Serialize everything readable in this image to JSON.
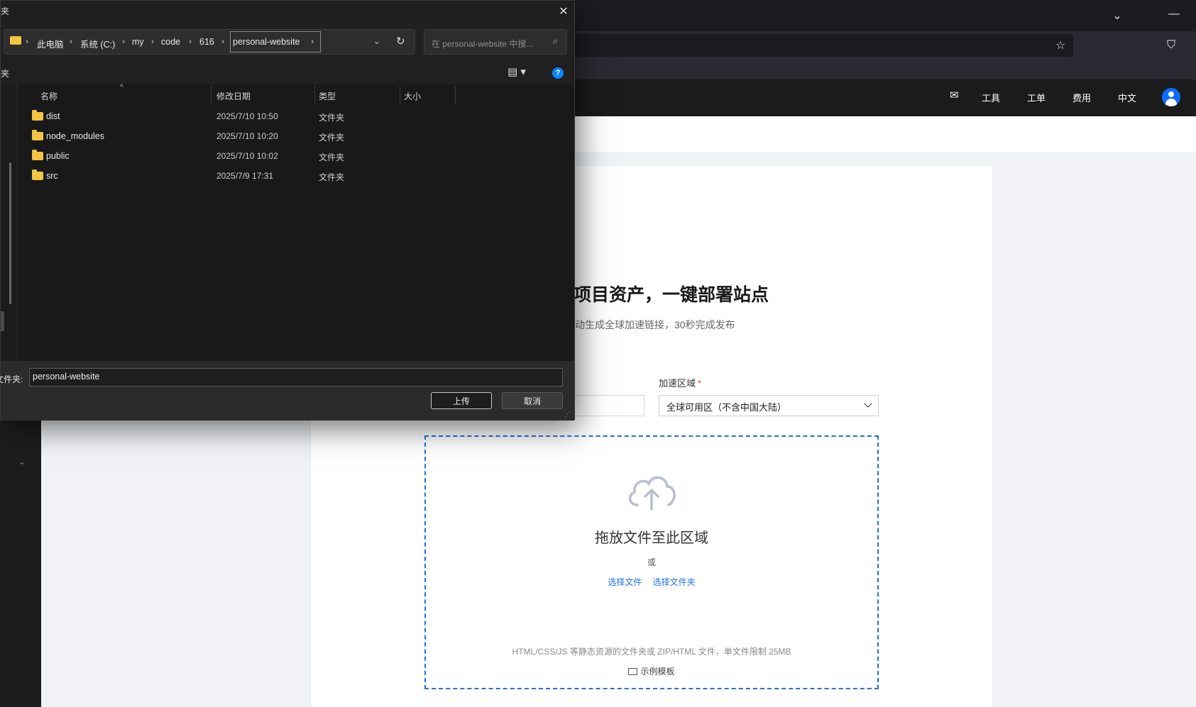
{
  "browser": {
    "chevron_icon": "chevron-down-icon",
    "minimize_icon": "minimize-icon",
    "bookmark_icon": "star-icon",
    "pocket_icon": "pocket-icon"
  },
  "site": {
    "nav": {
      "mail_icon": "mail-icon",
      "tools": "工具",
      "tickets": "工单",
      "billing": "费用",
      "language": "中文"
    },
    "hero": {
      "title_fragment": "项目资产，一键部署站点",
      "subtitle_fragment": "动生成全球加速链接，30秒完成发布"
    },
    "form": {
      "region_label": "加速区域",
      "region_required": "*",
      "region_value": "全球可用区（不含中国大陆）"
    },
    "dropzone": {
      "title": "拖放文件至此区域",
      "or": "或",
      "choose_file": "选择文件",
      "choose_folder": "选择文件夹",
      "hint": "HTML/CSS/JS 等静态资源的文件夹或 ZIP/HTML 文件，单文件限制 25MB",
      "sample_template": "示例模板"
    },
    "accent_color": "#1f6fe5"
  },
  "dialog": {
    "title_fragment": "夹",
    "breadcrumb": [
      "此电脑",
      "系统 (C:)",
      "my",
      "code",
      "616",
      "personal-website"
    ],
    "search_placeholder": "在 personal-website 中搜...",
    "cmd_fragment": "夹",
    "columns": {
      "name": "名称",
      "modified": "修改日期",
      "type": "类型",
      "size": "大小"
    },
    "files": [
      {
        "name": "dist",
        "modified": "2025/7/10 10:50",
        "type": "文件夹"
      },
      {
        "name": "node_modules",
        "modified": "2025/7/10 10:20",
        "type": "文件夹"
      },
      {
        "name": "public",
        "modified": "2025/7/10 10:02",
        "type": "文件夹"
      },
      {
        "name": "src",
        "modified": "2025/7/9 17:31",
        "type": "文件夹"
      }
    ],
    "folder_label": "文件夹:",
    "folder_value": "personal-website",
    "upload_label": "上传",
    "cancel_label": "取消"
  }
}
